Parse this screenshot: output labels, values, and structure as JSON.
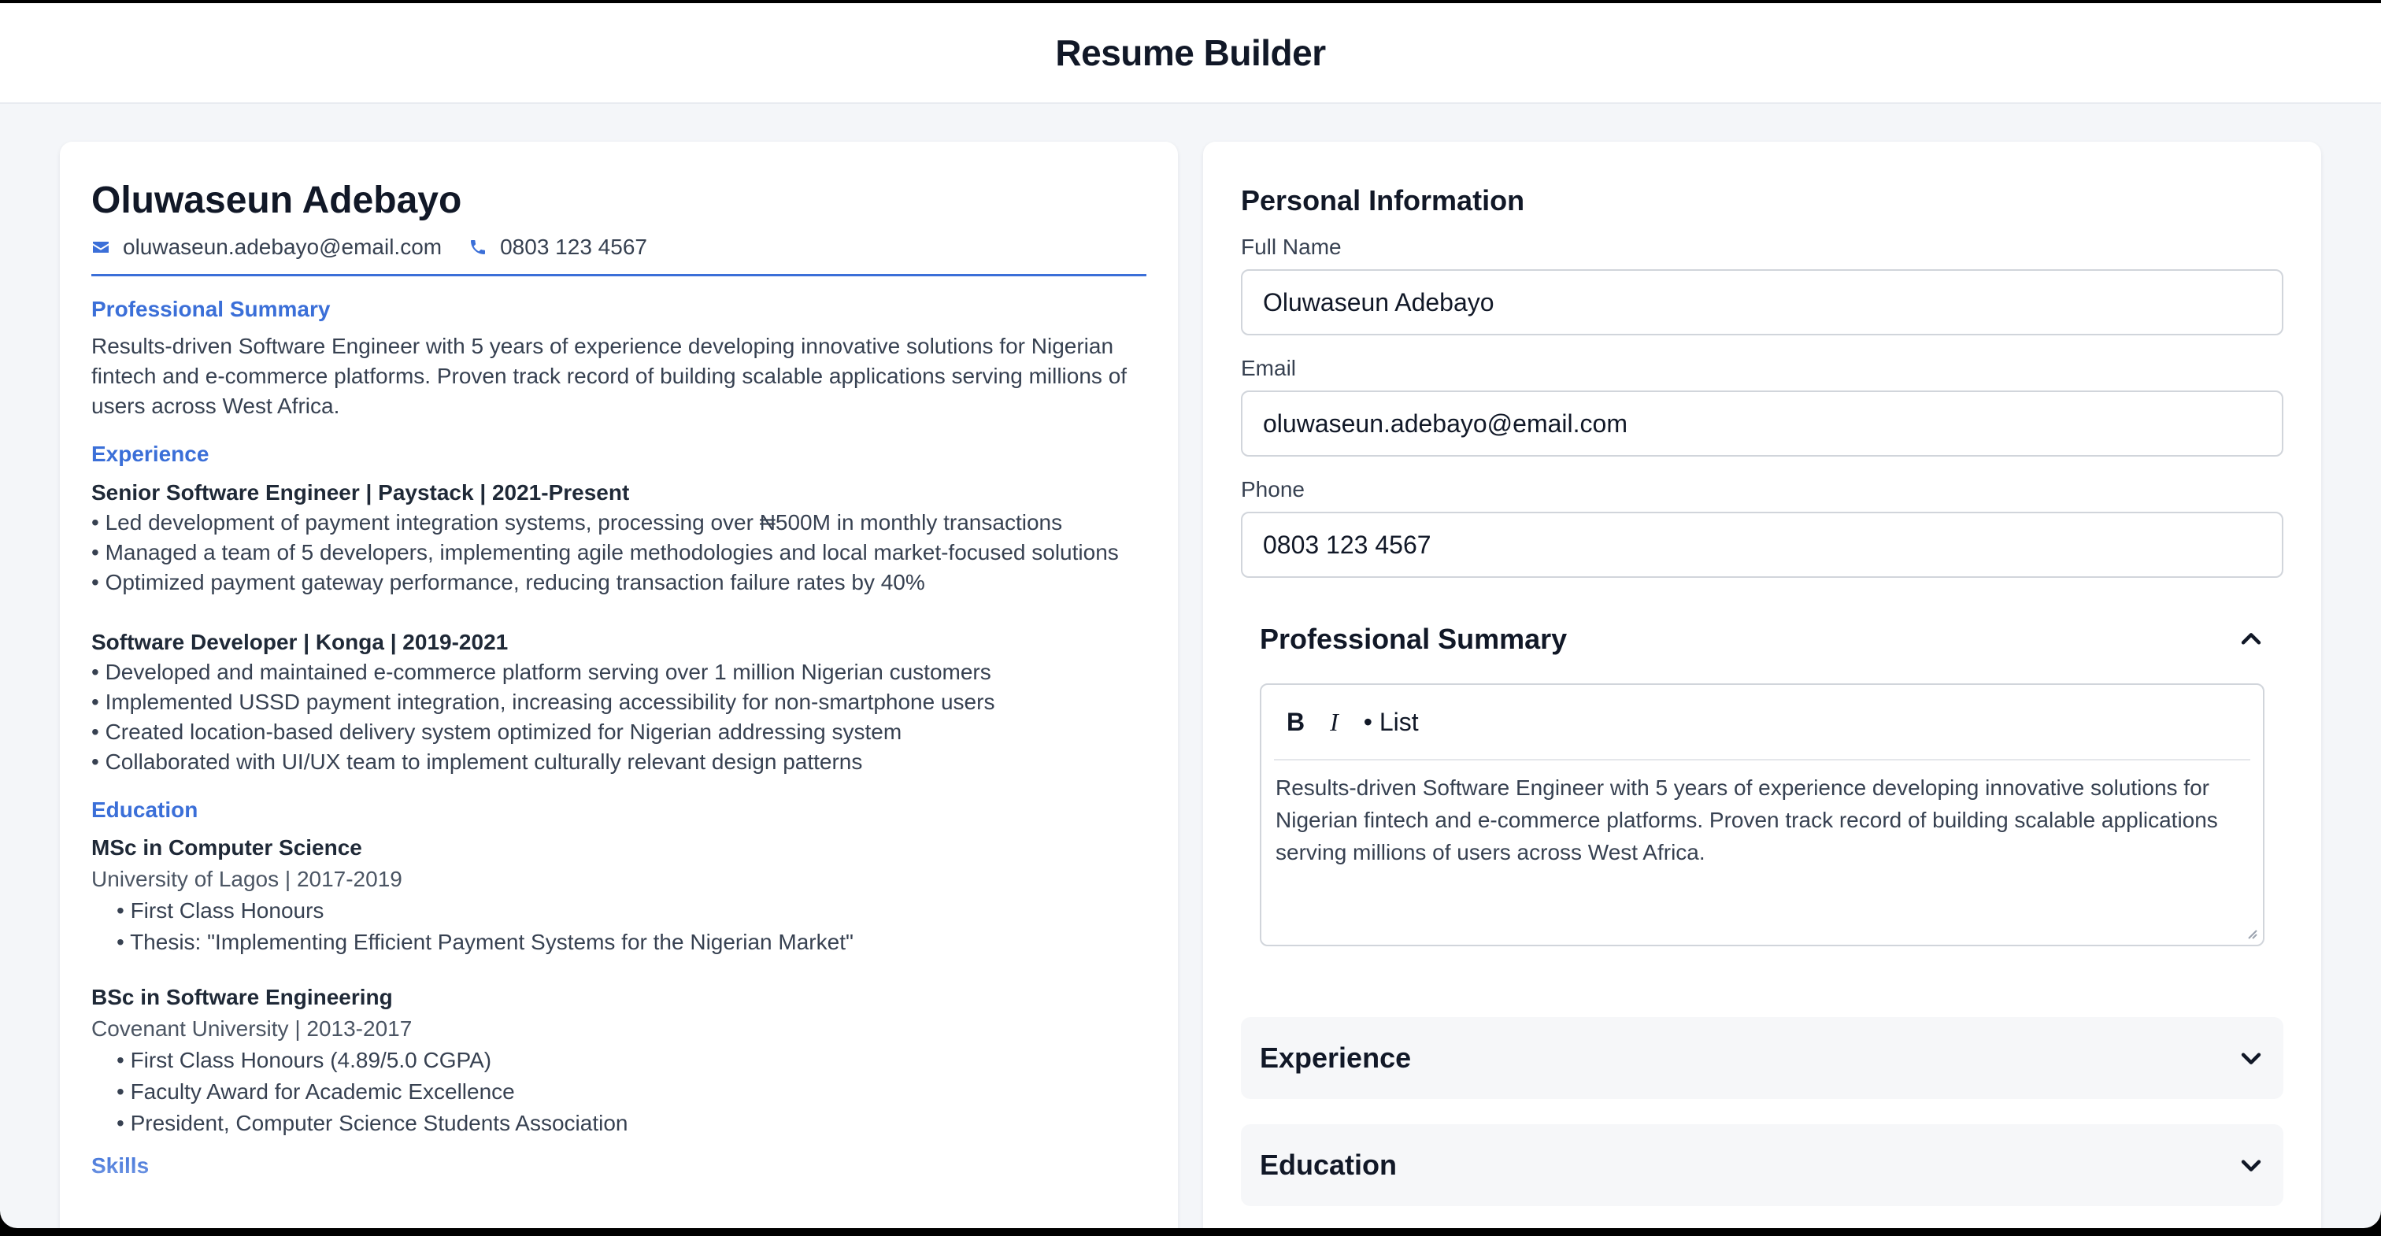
{
  "app": {
    "title": "Resume Builder"
  },
  "preview": {
    "name": "Oluwaseun Adebayo",
    "email": "oluwaseun.adebayo@email.com",
    "phone": "0803 123 4567",
    "summary_heading": "Professional Summary",
    "summary": "Results-driven Software Engineer with 5 years of experience developing innovative solutions for Nigerian fintech and e-commerce platforms. Proven track record of building scalable applications serving millions of users across West Africa.",
    "experience_heading": "Experience",
    "jobs": [
      {
        "title": "Senior Software Engineer | Paystack | 2021-Present",
        "bullets": [
          "• Led development of payment integration systems, processing over ₦500M in monthly transactions",
          "• Managed a team of 5 developers, implementing agile methodologies and local market-focused solutions",
          "• Optimized payment gateway performance, reducing transaction failure rates by 40%"
        ]
      },
      {
        "title": "Software Developer | Konga | 2019-2021",
        "bullets": [
          "• Developed and maintained e-commerce platform serving over 1 million Nigerian customers",
          "• Implemented USSD payment integration, increasing accessibility for non-smartphone users",
          "• Created location-based delivery system optimized for Nigerian addressing system",
          "• Collaborated with UI/UX team to implement culturally relevant design patterns"
        ]
      }
    ],
    "education_heading": "Education",
    "education": [
      {
        "degree": "MSc in Computer Science",
        "school": "University of Lagos | 2017-2019",
        "items": [
          "• First Class Honours",
          "• Thesis: \"Implementing Efficient Payment Systems for the Nigerian Market\""
        ]
      },
      {
        "degree": "BSc in Software Engineering",
        "school": "Covenant University | 2013-2017",
        "items": [
          "• First Class Honours (4.89/5.0 CGPA)",
          "• Faculty Award for Academic Excellence",
          "• President, Computer Science Students Association"
        ]
      }
    ],
    "skills_heading": "Skills"
  },
  "editor": {
    "heading": "Personal Information",
    "full_name_label": "Full Name",
    "full_name_value": "Oluwaseun Adebayo",
    "email_label": "Email",
    "email_value": "oluwaseun.adebayo@email.com",
    "phone_label": "Phone",
    "phone_value": "0803 123 4567",
    "summary_section": {
      "title": "Professional Summary",
      "toolbar": {
        "bold": "B",
        "italic": "I",
        "list": "• List"
      },
      "text": "Results-driven Software Engineer with 5 years of experience developing innovative solutions for Nigerian fintech and e-commerce platforms. Proven track record of building scalable applications serving millions of users across West Africa."
    },
    "experience_section": {
      "title": "Experience"
    },
    "education_section": {
      "title": "Education"
    }
  },
  "icons": {
    "email": "mail-icon",
    "phone": "phone-icon",
    "expanded": "chevron-up-icon",
    "collapsed": "chevron-down-icon"
  },
  "colors": {
    "accent": "#3b6fd8",
    "page_bg": "#f4f6f9",
    "card_bg": "#ffffff",
    "text": "#111827"
  }
}
